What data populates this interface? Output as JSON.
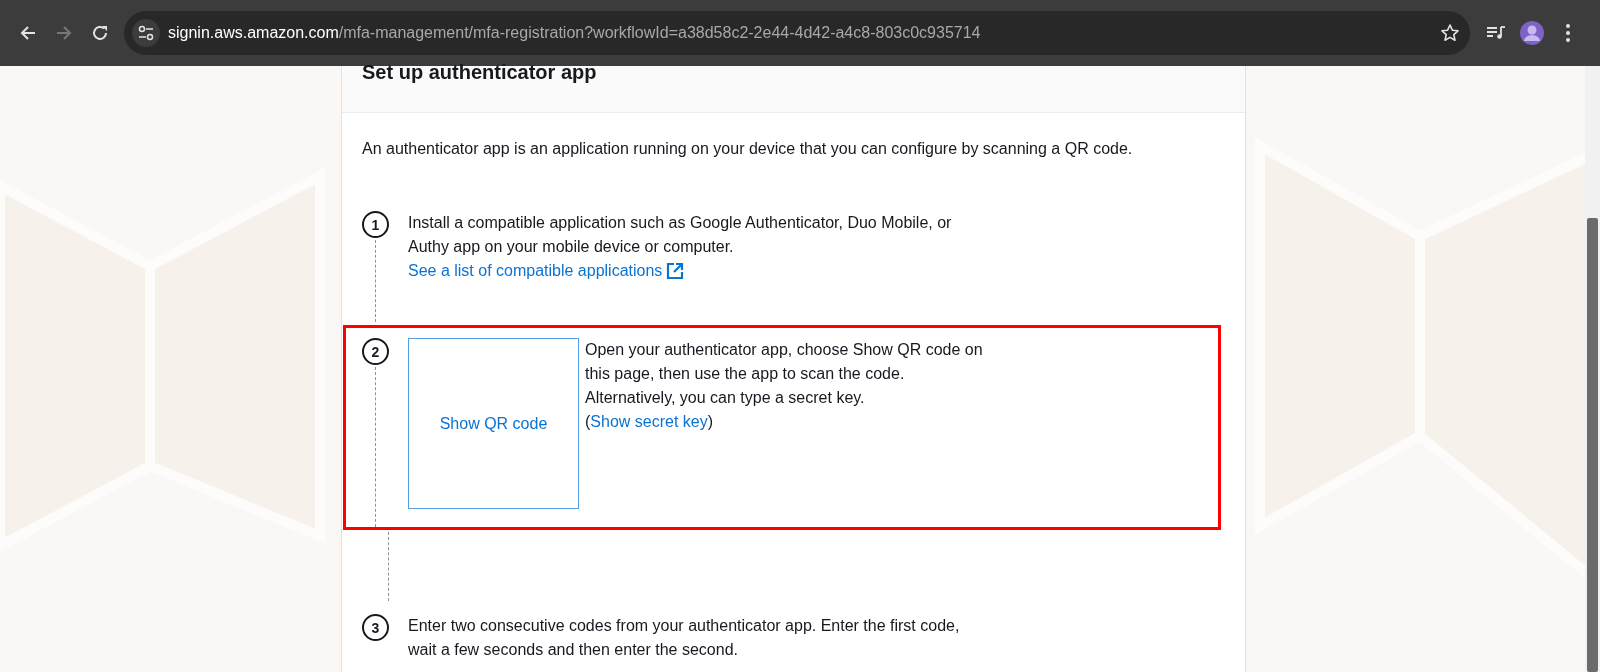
{
  "browser": {
    "back_disabled": false,
    "forward_disabled": true,
    "url_host": "signin.aws.amazon.com",
    "url_path": "/mfa-management/mfa-registration?workflowId=a38d58c2-2e44-4d42-a4c8-803c0c935714",
    "bookmarked": false
  },
  "card": {
    "title": "Set up authenticator app",
    "intro": "An authenticator app is an application running on your device that you can configure by scanning a QR code.",
    "steps": [
      {
        "kind": "text",
        "number": "1",
        "highlighted": false,
        "lines": [
          "Install a compatible application such as Google Authenticator, Duo Mobile, or",
          "Authy app on your mobile device or computer."
        ],
        "link": "See a list of compatible applications"
      },
      {
        "kind": "qr",
        "number": "2",
        "highlighted": true,
        "qr_button": "Show QR code",
        "lines": [
          "Open your authenticator app, choose Show QR code on",
          "this page, then use the app to scan the code.",
          "Alternatively, you can type a secret key."
        ],
        "link_before": "(",
        "link": "Show secret key",
        "link_after": ")"
      },
      {
        "kind": "text",
        "number": "3",
        "highlighted": false,
        "lines": [
          "Enter two consecutive codes from your authenticator app. Enter the first code,",
          "wait a few seconds and then enter the second."
        ]
      }
    ]
  }
}
